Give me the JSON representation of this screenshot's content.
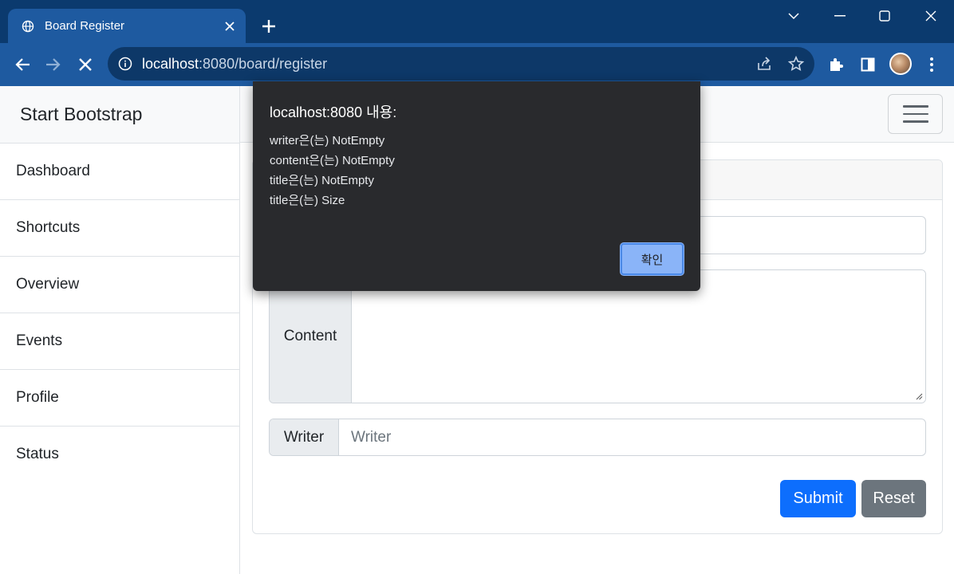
{
  "browser": {
    "tab_title": "Board Register",
    "url_host": "localhost",
    "url_rest": ":8080/board/register"
  },
  "sidebar": {
    "brand": "Start Bootstrap",
    "items": [
      {
        "label": "Dashboard"
      },
      {
        "label": "Shortcuts"
      },
      {
        "label": "Overview"
      },
      {
        "label": "Events"
      },
      {
        "label": "Profile"
      },
      {
        "label": "Status"
      }
    ]
  },
  "form": {
    "title_value": "",
    "content_label": "Content",
    "writer_label": "Writer",
    "writer_placeholder": "Writer",
    "submit_label": "Submit",
    "reset_label": "Reset"
  },
  "dialog": {
    "title": "localhost:8080 내용:",
    "messages": [
      "writer은(는) NotEmpty",
      "content은(는) NotEmpty",
      "title은(는) NotEmpty",
      "title은(는) Size"
    ],
    "ok_label": "확인"
  },
  "colors": {
    "primary": "#0d6efd",
    "secondary": "#6c757d",
    "chrome_frame": "#0b3a6e",
    "chrome_toolbar": "#1e5aa0",
    "dialog_bg": "#292a2d",
    "dialog_button": "#8ab4f8"
  },
  "icons": {
    "tab_favicon": "globe-icon",
    "close": "close-icon",
    "new_tab": "plus-icon",
    "back": "back-arrow-icon",
    "forward": "forward-arrow-icon",
    "stop": "stop-icon",
    "site_info": "info-icon",
    "share": "share-icon",
    "bookmark": "star-icon",
    "extensions": "puzzle-icon",
    "side_panel": "side-panel-icon",
    "menu": "kebab-menu-icon",
    "navbar_toggle": "hamburger-icon"
  }
}
